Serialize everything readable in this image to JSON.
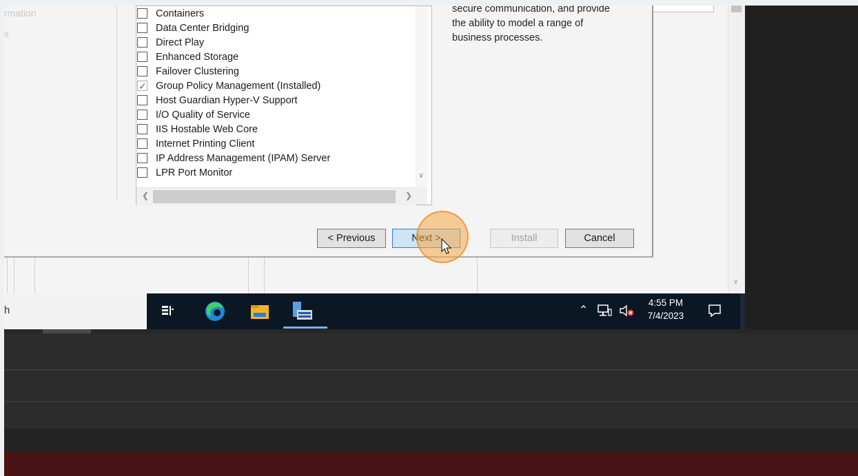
{
  "left_nav": {
    "item1": "rmation",
    "item2": "s"
  },
  "features": [
    {
      "label": "Containers",
      "checked": false
    },
    {
      "label": "Data Center Bridging",
      "checked": false
    },
    {
      "label": "Direct Play",
      "checked": false
    },
    {
      "label": "Enhanced Storage",
      "checked": false
    },
    {
      "label": "Failover Clustering",
      "checked": false
    },
    {
      "label": "Group Policy Management (Installed)",
      "checked": true
    },
    {
      "label": "Host Guardian Hyper-V Support",
      "checked": false
    },
    {
      "label": "I/O Quality of Service",
      "checked": false
    },
    {
      "label": "IIS Hostable Web Core",
      "checked": false
    },
    {
      "label": "Internet Printing Client",
      "checked": false
    },
    {
      "label": "IP Address Management (IPAM) Server",
      "checked": false
    },
    {
      "label": "LPR Port Monitor",
      "checked": false
    }
  ],
  "description": {
    "line1": "secure communication, and provide",
    "line2": "the ability to model a range of",
    "line3": "business processes."
  },
  "buttons": {
    "previous": "< Previous",
    "next": "Next >",
    "install": "Install",
    "cancel": "Cancel"
  },
  "taskbar": {
    "search_fragment": "h",
    "time": "4:55 PM",
    "date": "7/4/2023"
  },
  "colors": {
    "taskbar_bg": "#0c1724",
    "next_button_bg": "#cde5f7",
    "highlight": "#f6a846",
    "bottom_red": "#4a1416"
  }
}
